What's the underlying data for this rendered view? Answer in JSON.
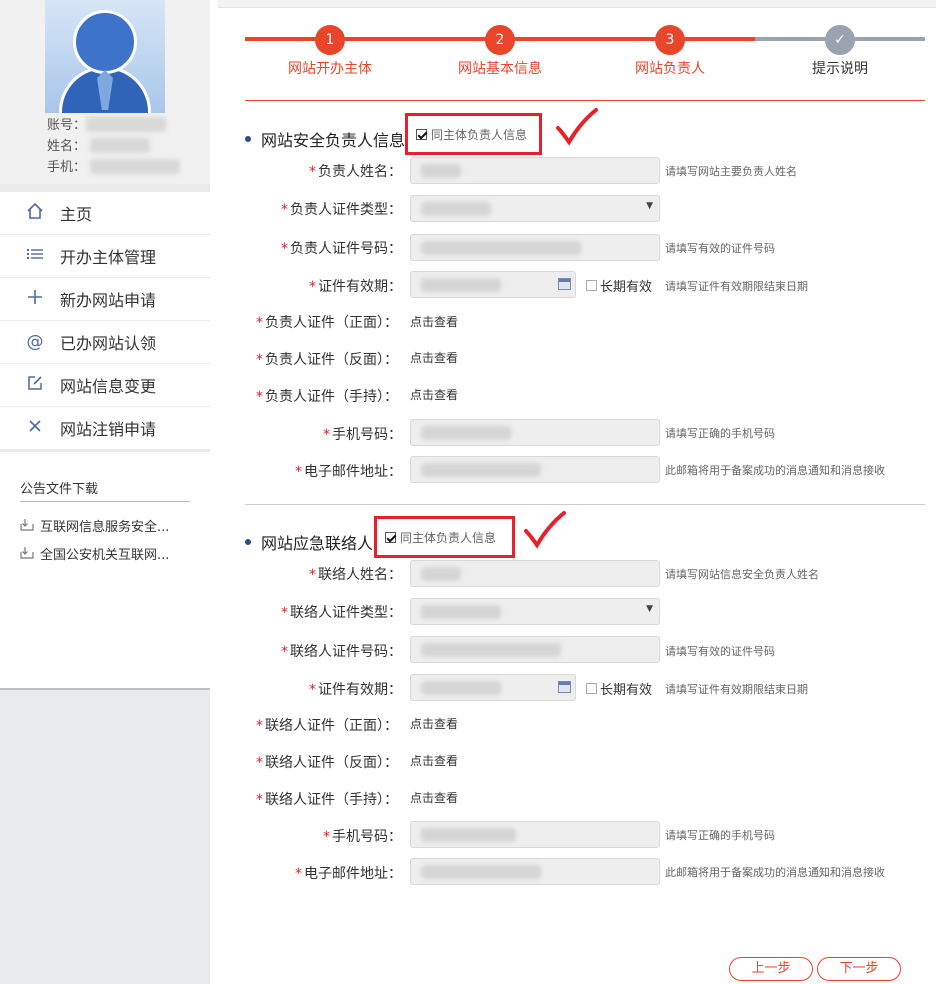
{
  "profile": {
    "account_label": "账号：",
    "name_label": "姓名：",
    "phone_label": "手机："
  },
  "menu": {
    "items": [
      {
        "label": "主页",
        "icon": "home-icon"
      },
      {
        "label": "开办主体管理",
        "icon": "list-icon"
      },
      {
        "label": "新办网站申请",
        "icon": "plus-icon"
      },
      {
        "label": "已办网站认领",
        "icon": "at-icon"
      },
      {
        "label": "网站信息变更",
        "icon": "edit-icon"
      },
      {
        "label": "网站注销申请",
        "icon": "close-icon"
      }
    ]
  },
  "downloads": {
    "title": "公告文件下载",
    "items": [
      "互联网信息服务安全...",
      "全国公安机关互联网..."
    ]
  },
  "steps": [
    {
      "num": "1",
      "label": "网站开办主体"
    },
    {
      "num": "2",
      "label": "网站基本信息"
    },
    {
      "num": "3",
      "label": "网站负责人"
    },
    {
      "num": "✓",
      "label": "提示说明"
    }
  ],
  "colors": {
    "accent": "#e8452b",
    "highlight_box": "#e8202a",
    "inactive_step": "#9aa3ae"
  },
  "section1": {
    "title": "网站安全负责人信息",
    "same_as_label": "同主体负责人信息",
    "fields": {
      "name": {
        "label": "负责人姓名：",
        "hint": "请填写网站主要负责人姓名"
      },
      "id_type": {
        "label": "负责人证件类型：",
        "hint": ""
      },
      "id_number": {
        "label": "负责人证件号码：",
        "hint": "请填写有效的证件号码"
      },
      "validity": {
        "label": "证件有效期：",
        "long_term": "长期有效",
        "hint": "请填写证件有效期限结束日期"
      },
      "cert_front": {
        "label": "负责人证件（正面）：",
        "link": "点击查看"
      },
      "cert_back": {
        "label": "负责人证件（反面）：",
        "link": "点击查看"
      },
      "cert_hand": {
        "label": "负责人证件（手持）：",
        "link": "点击查看"
      },
      "phone": {
        "label": "手机号码：",
        "hint": "请填写正确的手机号码"
      },
      "email": {
        "label": "电子邮件地址：",
        "hint": "此邮箱将用于备案成功的消息通知和消息接收"
      }
    }
  },
  "section2": {
    "title": "网站应急联络人",
    "same_as_label": "同主体负责人信息",
    "fields": {
      "name": {
        "label": "联络人姓名：",
        "hint": "请填写网站信息安全负责人姓名"
      },
      "id_type": {
        "label": "联络人证件类型：",
        "hint": ""
      },
      "id_number": {
        "label": "联络人证件号码：",
        "hint": "请填写有效的证件号码"
      },
      "validity": {
        "label": "证件有效期：",
        "long_term": "长期有效",
        "hint": "请填写证件有效期限结束日期"
      },
      "cert_front": {
        "label": "联络人证件（正面）：",
        "link": "点击查看"
      },
      "cert_back": {
        "label": "联络人证件（反面）：",
        "link": "点击查看"
      },
      "cert_hand": {
        "label": "联络人证件（手持）：",
        "link": "点击查看"
      },
      "phone": {
        "label": "手机号码：",
        "hint": "请填写正确的手机号码"
      },
      "email": {
        "label": "电子邮件地址：",
        "hint": "此邮箱将用于备案成功的消息通知和消息接收"
      }
    }
  },
  "buttons": {
    "prev": "上一步",
    "next": "下一步"
  }
}
